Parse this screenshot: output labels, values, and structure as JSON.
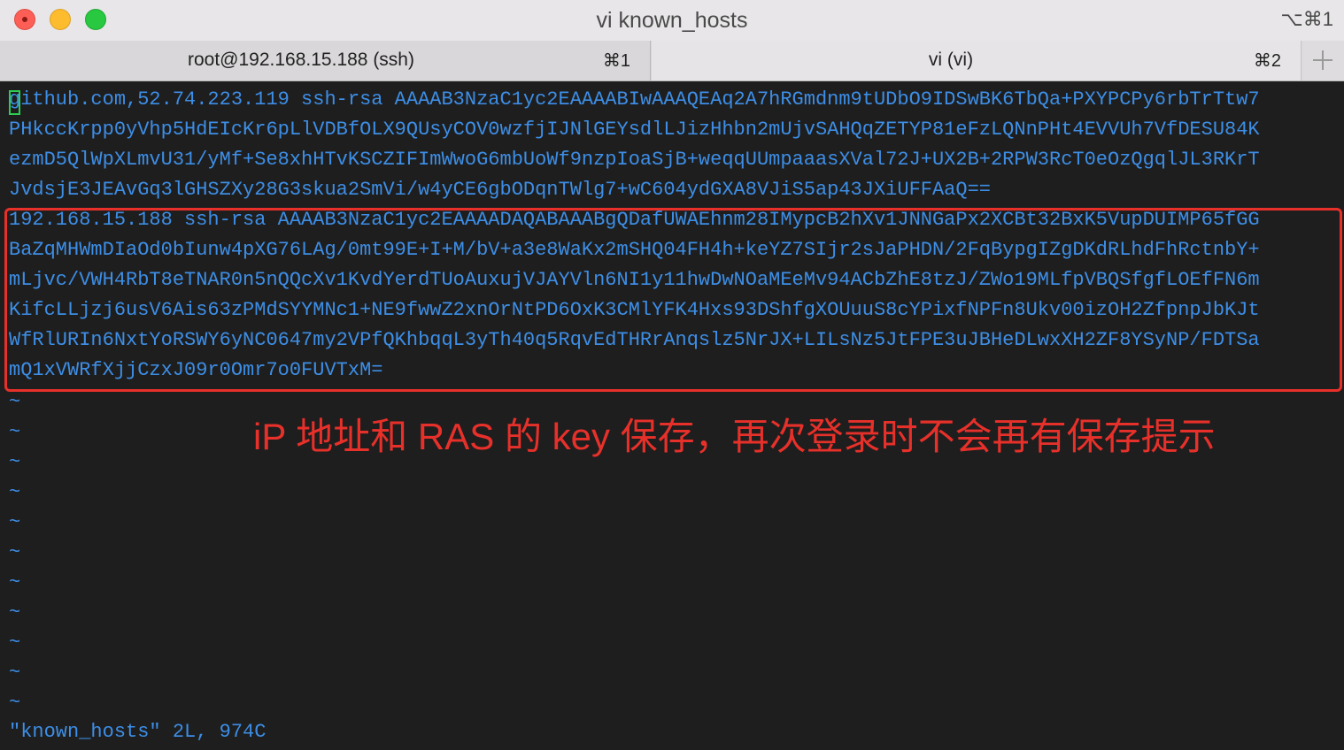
{
  "window": {
    "title": "vi known_hosts",
    "shortcut": "⌥⌘1"
  },
  "tabs": [
    {
      "label": "root@192.168.15.188 (ssh)",
      "shortcut": "⌘1"
    },
    {
      "label": "vi (vi)",
      "shortcut": "⌘2"
    }
  ],
  "terminal": {
    "lines": [
      "github.com,52.74.223.119 ssh-rsa AAAAB3NzaC1yc2EAAAABIwAAAQEAq2A7hRGmdnm9tUDbO9IDSwBK6TbQa+PXYPCPy6rbTrTtw7",
      "PHkccKrpp0yVhp5HdEIcKr6pLlVDBfOLX9QUsyCOV0wzfjIJNlGEYsdlLJizHhbn2mUjvSAHQqZETYP81eFzLQNnPHt4EVVUh7VfDESU84K",
      "ezmD5QlWpXLmvU31/yMf+Se8xhHTvKSCZIFImWwoG6mbUoWf9nzpIoaSjB+weqqUUmpaaasXVal72J+UX2B+2RPW3RcT0eOzQgqlJL3RKrT",
      "JvdsjE3JEAvGq3lGHSZXy28G3skua2SmVi/w4yCE6gbODqnTWlg7+wC604ydGXA8VJiS5ap43JXiUFFAaQ==",
      "192.168.15.188 ssh-rsa AAAAB3NzaC1yc2EAAAADAQABAAABgQDafUWAEhnm28IMypcB2hXv1JNNGaPx2XCBt32BxK5VupDUIMP65fGG",
      "BaZqMHWmDIaOd0bIunw4pXG76LAg/0mt99E+I+M/bV+a3e8WaKx2mSHQ04FH4h+keYZ7SIjr2sJaPHDN/2FqBypgIZgDKdRLhdFhRctnbY+",
      "mLjvc/VWH4RbT8eTNAR0n5nQQcXv1KvdYerdTUoAuxujVJAYVln6NI1y11hwDwNOaMEeMv94ACbZhE8tzJ/ZWo19MLfpVBQSfgfLOEfFN6m",
      "KifcLLjzj6usV6Ais63zPMdSYYMNc1+NE9fwwZ2xnOrNtPD6OxK3CMlYFK4Hxs93DShfgXOUuuS8cYPixfNPFn8Ukv00izOH2ZfpnpJbKJt",
      "WfRlURIn6NxtYoRSWY6yNC0647my2VPfQKhbqqL3yTh40q5RqvEdTHRrAnqslz5NrJX+LILsNz5JtFPE3uJBHeDLwxXH2ZF8YSyNP/FDTSa",
      "mQ1xVWRfXjjCzxJ09r0Omr7o0FUVTxM="
    ],
    "empty_line_marker": "~",
    "status_line": "\"known_hosts\" 2L, 974C"
  },
  "annotation": {
    "text": "iP 地址和 RAS 的 key 保存，再次登录时不会再有保存提示"
  },
  "colors": {
    "terminal_text": "#3d8ee6",
    "annotation": "#e8302a",
    "cursor": "#2ecc52"
  }
}
